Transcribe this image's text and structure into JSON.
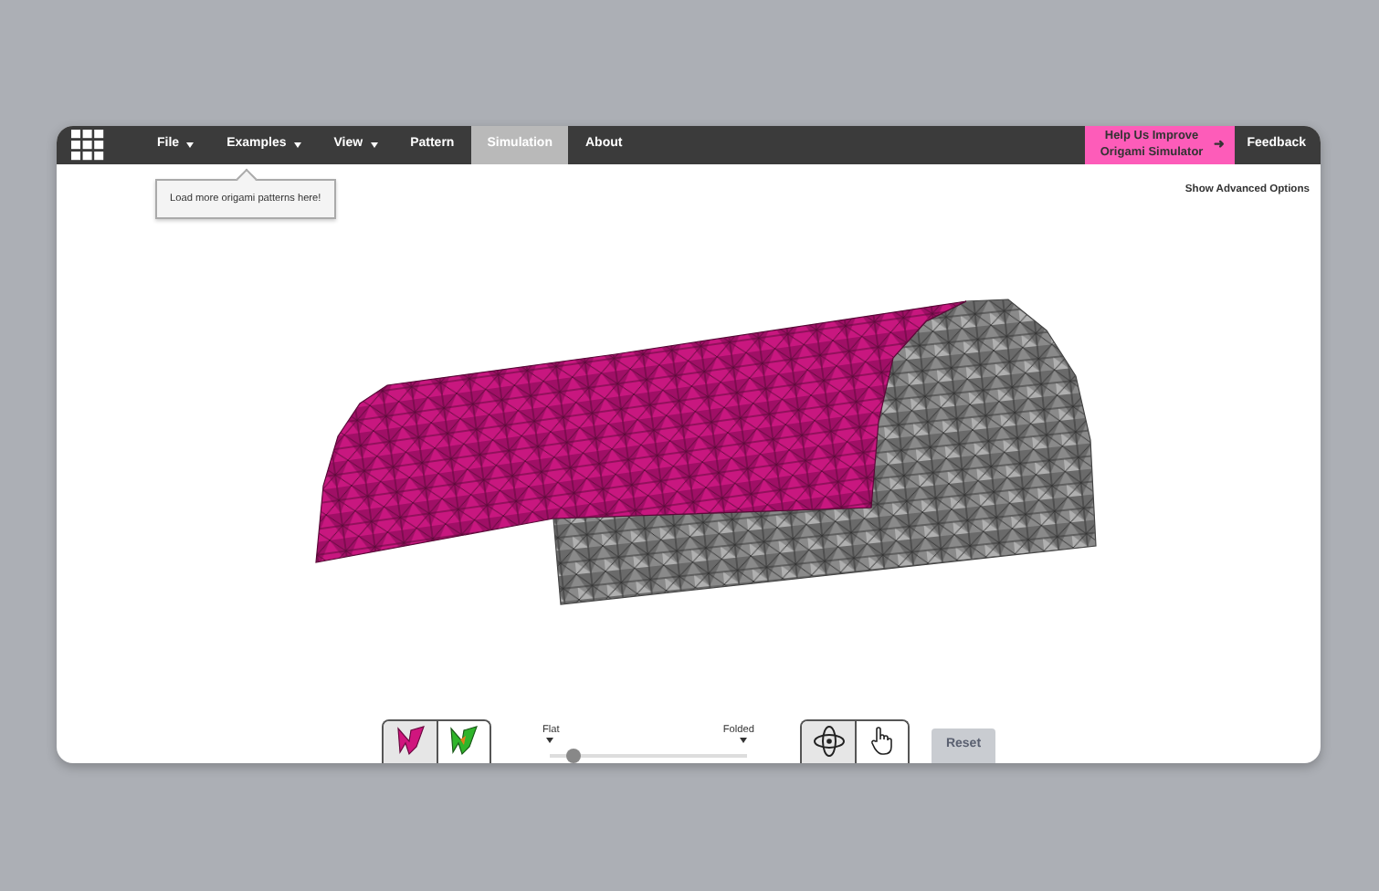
{
  "menu": [
    {
      "label": "File",
      "dropdown": true,
      "selected": false
    },
    {
      "label": "Examples",
      "dropdown": true,
      "selected": false
    },
    {
      "label": "View",
      "dropdown": true,
      "selected": false
    },
    {
      "label": "Pattern",
      "dropdown": false,
      "selected": false
    },
    {
      "label": "Simulation",
      "dropdown": false,
      "selected": true
    },
    {
      "label": "About",
      "dropdown": false,
      "selected": false
    }
  ],
  "promo": {
    "lines": [
      "Help Us Improve",
      "Origami Simulator"
    ],
    "arrow": "➜"
  },
  "feedback": "Feedback",
  "tooltip": "Load more origami patterns here!",
  "advanced_link": "Show Advanced Options",
  "view_modes": [
    {
      "kind": "material",
      "selected": true
    },
    {
      "kind": "strain",
      "selected": false
    }
  ],
  "slider": {
    "min_label": "Flat",
    "max_label": "Folded",
    "level": 0.12
  },
  "tools": [
    {
      "kind": "rotate",
      "selected": true
    },
    {
      "kind": "grab",
      "selected": false
    }
  ],
  "reset": "Reset"
}
